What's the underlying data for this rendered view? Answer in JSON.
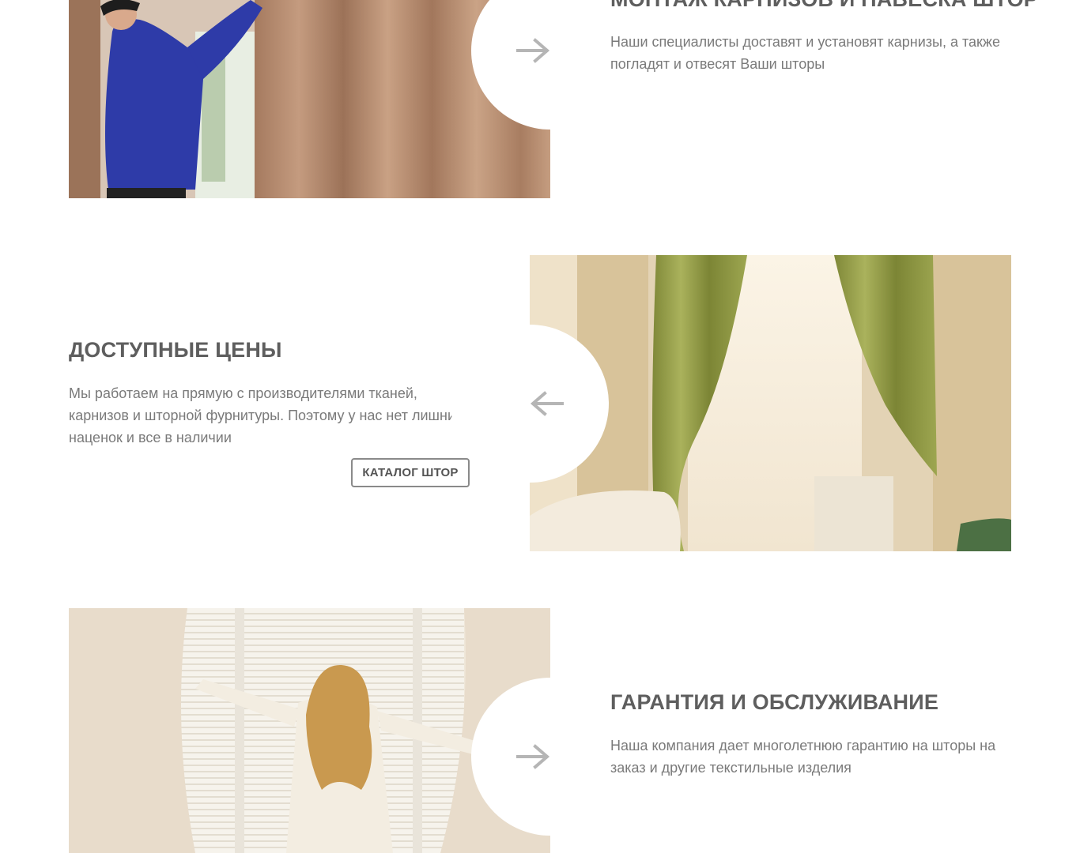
{
  "features": [
    {
      "title": "МОНТАЖ КАРНИЗОВ И НАВЕСКА ШТОР",
      "text": "Наши специалисты доставят и установят карнизы, а также погладят и отвесят Ваши шторы",
      "image": "installer-hanging-curtains-photo",
      "arrow_icon": "arrow-right-icon"
    },
    {
      "title": "ДОСТУПНЫЕ ЦЕНЫ",
      "text": "Мы работаем на прямую с производителями тканей, карнизов и шторной фурнитуры. Поэтому у нас нет лишних наценок и все в наличии",
      "button_label": "КАТАЛОГ ШТОР",
      "image": "green-curtains-living-room-photo",
      "arrow_icon": "arrow-left-icon"
    },
    {
      "title": "ГАРАНТИЯ И ОБСЛУЖИВАНИЕ",
      "text": "Наша компания дает многолетнюю гарантию на шторы на заказ и другие текстильные изделия",
      "image": "woman-opening-curtains-photo",
      "arrow_icon": "arrow-right-icon"
    }
  ],
  "colors": {
    "heading": "#5e5e5e",
    "text": "#7a7a7a",
    "arrow": "#b5b5b5",
    "button_border": "#8a8a8a"
  }
}
